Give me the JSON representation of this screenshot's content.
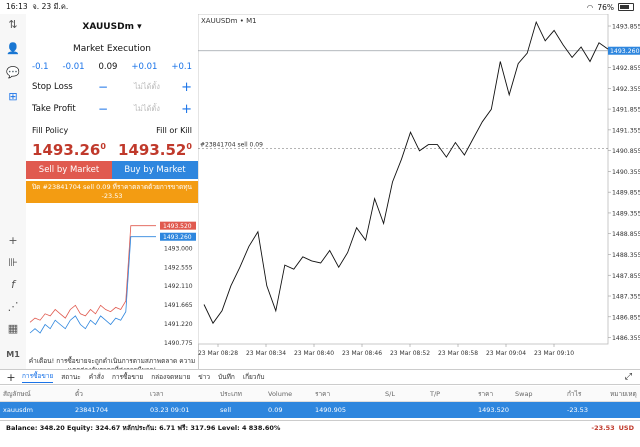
{
  "status_bar": {
    "time": "16:13",
    "date": "จ. 23 มี.ค.",
    "battery": "76%"
  },
  "order_panel": {
    "symbol": "XAUUSDm",
    "execution": "Market Execution",
    "volume": {
      "m1": "-0.1",
      "m2": "-0.01",
      "value": "0.09",
      "p1": "+0.01",
      "p2": "+0.1"
    },
    "stop_loss": {
      "label": "Stop Loss",
      "placeholder": "ไม่ได้ตั้ง"
    },
    "take_profit": {
      "label": "Take Profit",
      "placeholder": "ไม่ได้ตั้ง"
    },
    "fill_policy": {
      "label": "Fill Policy",
      "value": "Fill or Kill"
    },
    "bid": {
      "main": "1493.26",
      "sup": "0"
    },
    "ask": {
      "main": "1493.52",
      "sup": "0"
    },
    "sell_label": "Sell by Market",
    "buy_label": "Buy by Market",
    "banner": "ปิด #23841704 sell 0.09 ที่ราคาตลาดด้วยการขาดทุน -23.53",
    "warning": "คำเตือน! การซื้อขายจะถูกดำเนินการตามสภาพตลาด ความแตกต่างกับราคาที่ส่งอาจมีมาก!"
  },
  "mini_chart": {
    "ticks": [
      "1493.000",
      "1492.555",
      "1492.110",
      "1491.665",
      "1491.220",
      "1490.775"
    ],
    "ask_label": "1493.520",
    "bid_label": "1493.260",
    "bid_series": [
      1491.0,
      1491.1,
      1491.0,
      1491.2,
      1491.1,
      1491.3,
      1491.2,
      1491.1,
      1491.3,
      1491.4,
      1491.2,
      1491.1,
      1491.3,
      1491.2,
      1491.4,
      1491.3,
      1491.2,
      1491.35,
      1491.3,
      1491.5,
      1493.26,
      1493.26,
      1493.26,
      1493.26,
      1493.26,
      1493.26
    ],
    "ask_series": [
      1491.25,
      1491.35,
      1491.3,
      1491.45,
      1491.4,
      1491.55,
      1491.45,
      1491.35,
      1491.55,
      1491.65,
      1491.45,
      1491.4,
      1491.55,
      1491.45,
      1491.65,
      1491.55,
      1491.5,
      1491.6,
      1491.55,
      1491.75,
      1493.52,
      1493.52,
      1493.52,
      1493.52,
      1493.52,
      1493.52
    ],
    "colors": {
      "bid": "#2e86de",
      "ask": "#e05a4f"
    }
  },
  "chart_data": {
    "type": "line",
    "title": "XAUUSDm • M1",
    "x_labels": [
      "23 Mar 08:28",
      "23 Mar 08:34",
      "23 Mar 08:40",
      "23 Mar 08:46",
      "23 Mar 08:52",
      "23 Mar 08:58",
      "23 Mar 09:04",
      "23 Mar 09:10"
    ],
    "y_ticks": [
      "1493.855",
      "1493.260",
      "1492.855",
      "1492.355",
      "1491.855",
      "1491.355",
      "1490.855",
      "1490.355",
      "1489.855",
      "1489.355",
      "1488.855",
      "1488.355",
      "1487.855",
      "1487.355",
      "1486.855",
      "1486.355"
    ],
    "ylim": [
      1486.2,
      1494.0
    ],
    "values": [
      1487.15,
      1486.7,
      1487.0,
      1487.6,
      1488.05,
      1488.55,
      1488.9,
      1487.6,
      1487.0,
      1488.1,
      1488.0,
      1488.3,
      1488.2,
      1488.15,
      1488.45,
      1488.05,
      1488.4,
      1489.0,
      1488.7,
      1489.7,
      1489.1,
      1490.1,
      1490.65,
      1491.3,
      1490.85,
      1491.0,
      1491.0,
      1490.7,
      1491.05,
      1490.75,
      1491.15,
      1491.55,
      1491.85,
      1493.0,
      1492.2,
      1492.95,
      1493.2,
      1493.95,
      1493.5,
      1493.75,
      1493.4,
      1493.1,
      1493.35,
      1493.0,
      1493.45,
      1493.3
    ],
    "hlines": [
      {
        "label": "",
        "value": 1493.26,
        "color": "#9aa0a6"
      },
      {
        "label": "#23841704 sell 0.09",
        "value": 1490.905,
        "color": "#888888"
      }
    ],
    "current_price_label": "1493.260"
  },
  "bottom_tabs": [
    "การซื้อขาย",
    "สถานะ",
    "คำสั่ง",
    "การซื้อขาย",
    "กล่องจดหมาย",
    "ข่าว",
    "บันทึก",
    "เกี่ยวกับ"
  ],
  "table": {
    "headers": [
      "สัญลักษณ์",
      "ตั๋ว",
      "เวลา",
      "ประเภท",
      "Volume",
      "ราคา",
      "S/L",
      "T/P",
      "ราคา",
      "Swap",
      "กำไร",
      "หมายเหตุ"
    ],
    "rows": [
      [
        "xauusdm",
        "23841704",
        "03.23 09:01",
        "sell",
        "0.09",
        "1490.905",
        "",
        "",
        "1493.520",
        "",
        "-23.53",
        ""
      ]
    ]
  },
  "balance": {
    "text": "Balance: 348.20 Equity: 324.67 หลักประกัน: 6.71 ฟรี: 317.96 Level: 4 838.60%",
    "pl": "-23.53",
    "currency": "USD"
  }
}
